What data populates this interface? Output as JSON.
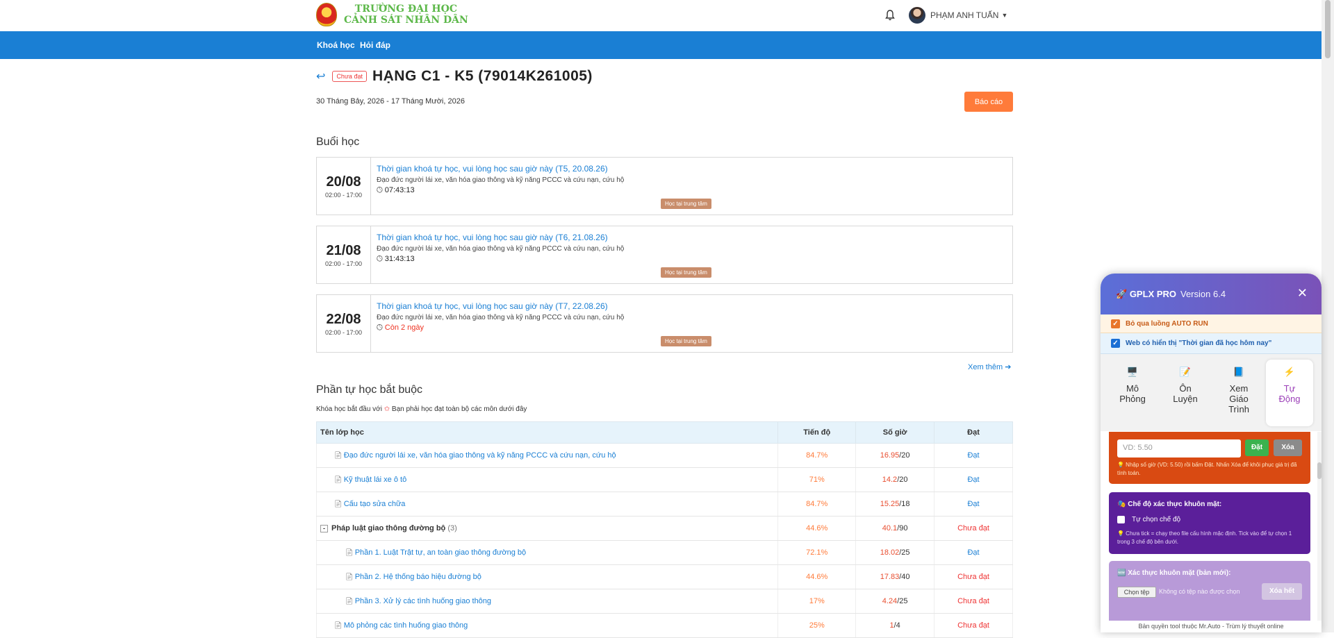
{
  "header": {
    "logo_line1": "TRƯỜNG ĐẠI HỌC",
    "logo_line2": "CẢNH SÁT NHÂN DÂN",
    "user_name": "PHẠM ANH TUẤN"
  },
  "nav": {
    "courses": "Khoá học",
    "qa": "Hỏi đáp"
  },
  "course": {
    "status": "Chưa đạt",
    "title": "HẠNG C1 - K5 (79014K261005)",
    "date_range": "30 Tháng Bảy, 2026 - 17 Tháng Mười, 2026",
    "report_label": "Báo cáo"
  },
  "sessions_title": "Buổi học",
  "sessions": [
    {
      "date": "20/08",
      "time": "02:00 - 17:00",
      "title": "Thời gian khoá tự học, vui lòng học sau giờ này (T5, 20.08.26)",
      "subject": "Đạo đức người lái xe, văn hóa giao thông và kỹ năng PCCC và cứu nạn, cứu hộ",
      "countdown": "07:43:13",
      "tag": "Học tại trung tâm"
    },
    {
      "date": "21/08",
      "time": "02:00 - 17:00",
      "title": "Thời gian khoá tự học, vui lòng học sau giờ này (T6, 21.08.26)",
      "subject": "Đạo đức người lái xe, văn hóa giao thông và kỹ năng PCCC và cứu nạn, cứu hộ",
      "countdown": "31:43:13",
      "tag": "Học tại trung tâm"
    },
    {
      "date": "22/08",
      "time": "02:00 - 17:00",
      "title": "Thời gian khoá tự học, vui lòng học sau giờ này (T7, 22.08.26)",
      "subject": "Đạo đức người lái xe, văn hóa giao thông và kỹ năng PCCC và cứu nạn, cứu hộ",
      "countdown": "Còn 2 ngày",
      "tag": "Học tại trung tâm"
    }
  ],
  "more_label": "Xem thêm",
  "selfstudy": {
    "title": "Phần tự học bắt buộc",
    "note_pre": "Khóa học bắt đầu với",
    "note_star": "✩",
    "note_post": "Bạn phải học đạt toàn bộ các môn dưới đây",
    "headers": {
      "name": "Tên lớp học",
      "progress": "Tiến độ",
      "hours": "Số giờ",
      "pass": "Đạt"
    },
    "rows": [
      {
        "name": "Đạo đức người lái xe, văn hóa giao thông và kỹ năng PCCC và cứu nạn, cứu hộ",
        "progress": "84.7%",
        "done": "16.95",
        "total": "/20",
        "status": "Đạt"
      },
      {
        "name": "Kỹ thuật lái xe ô tô",
        "progress": "71%",
        "done": "14.2",
        "total": "/20",
        "status": "Đạt"
      },
      {
        "name": "Cấu tạo sửa chữa",
        "progress": "84.7%",
        "done": "15.25",
        "total": "/18",
        "status": "Đạt"
      },
      {
        "name": "Pháp luật giao thông đường bộ",
        "count": "(3)",
        "progress": "44.6%",
        "done": "40.1",
        "total": "/90",
        "status": "Chưa đạt"
      },
      {
        "name": "Phần 1. Luật Trật tự, an toàn giao thông đường bộ",
        "progress": "72.1%",
        "done": "18.02",
        "total": "/25",
        "status": "Đạt"
      },
      {
        "name": "Phần 2. Hệ thống báo hiệu đường bộ",
        "progress": "44.6%",
        "done": "17.83",
        "total": "/40",
        "status": "Chưa đạt"
      },
      {
        "name": "Phần 3. Xử lý các tình huống giao thông",
        "progress": "17%",
        "done": "4.24",
        "total": "/25",
        "status": "Chưa đạt"
      },
      {
        "name": "Mô phỏng các tình huống giao thông",
        "progress": "25%",
        "done": "1",
        "total": "/4",
        "status": "Chưa đạt"
      }
    ]
  },
  "panel": {
    "title": "GPLX PRO",
    "version": "Version 6.4",
    "opt_autorun": "Bỏ qua luồng AUTO RUN",
    "opt_web": "Web có hiển thị \"Thời gian đã học hôm nay\"",
    "tabs": [
      {
        "line1": "Mô",
        "line2": "Phỏng",
        "line3": ""
      },
      {
        "line1": "Ôn",
        "line2": "Luyện",
        "line3": ""
      },
      {
        "line1": "Xem",
        "line2": "Giáo",
        "line3": "Trình"
      },
      {
        "line1": "Tự",
        "line2": "Động",
        "line3": ""
      }
    ],
    "hours_placeholder": "VD: 5.50",
    "set_label": "Đặt",
    "delete_label": "Xóa",
    "hours_hint": "💡 Nhập số giờ (VD: 5.50) rồi bấm Đặt. Nhấn Xóa để khôi phục giá trị đã tính toán.",
    "face_mode_title": "🎭 Chế độ xác thực khuôn mặt:",
    "face_mode_option": "Tự chọn chế độ",
    "face_mode_hint": "💡 Chưa tick = chạy theo file cấu hình mặc định. Tick vào để tự chọn 1 trong 3 chế độ bên dưới.",
    "face_new_title": "🆕 Xác thực khuôn mặt (bản mới):",
    "choose_file": "Chọn tệp",
    "no_file": "Không có tệp nào được chọn",
    "clear_label": "Xóa hết",
    "footer": "Bản quyền tool thuộc Mr.Auto - Trùm lý thuyết online"
  }
}
